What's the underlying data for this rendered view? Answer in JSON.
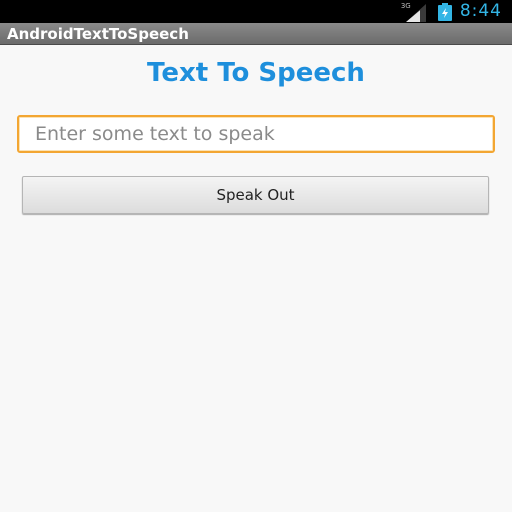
{
  "status_bar": {
    "network_type": "3G",
    "time": "8:44",
    "icons": [
      "signal-icon",
      "battery-icon"
    ],
    "clock_color": "#33b5e5"
  },
  "app": {
    "title": "AndroidTextToSpeech"
  },
  "main": {
    "heading": "Text To Speech",
    "heading_color": "#1e8fdc",
    "input": {
      "value": "",
      "placeholder": "Enter some text to speak",
      "focus_color": "#f3a632"
    },
    "button_label": "Speak Out"
  }
}
